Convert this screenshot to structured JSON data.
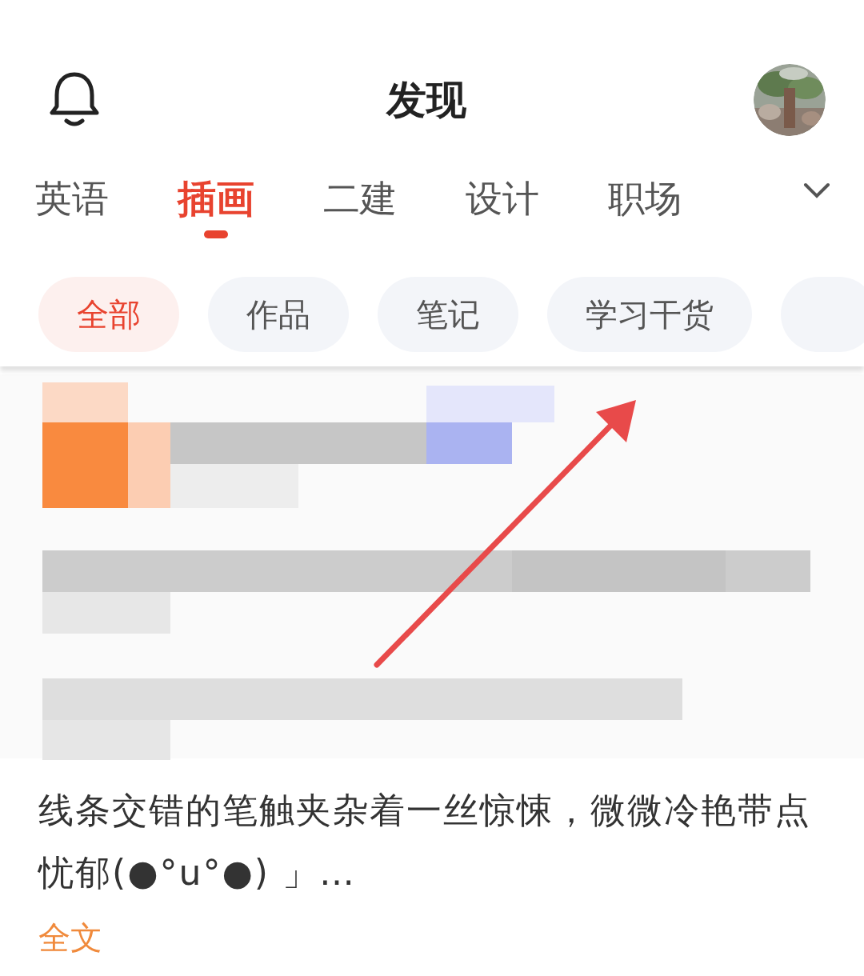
{
  "header": {
    "title": "发现"
  },
  "tabs": [
    {
      "label": "英语",
      "selected": false
    },
    {
      "label": "插画",
      "selected": true
    },
    {
      "label": "二建",
      "selected": false
    },
    {
      "label": "设计",
      "selected": false
    },
    {
      "label": "职场",
      "selected": false
    }
  ],
  "filters": [
    {
      "label": "全部",
      "selected": true
    },
    {
      "label": "作品",
      "selected": false
    },
    {
      "label": "笔记",
      "selected": false
    },
    {
      "label": "学习干货",
      "selected": false
    }
  ],
  "post": {
    "text": "线条交错的笔触夹杂着一丝惊悚，微微冷艳带点忧郁(●°u°●)​ 」…",
    "more_link": "全文"
  }
}
